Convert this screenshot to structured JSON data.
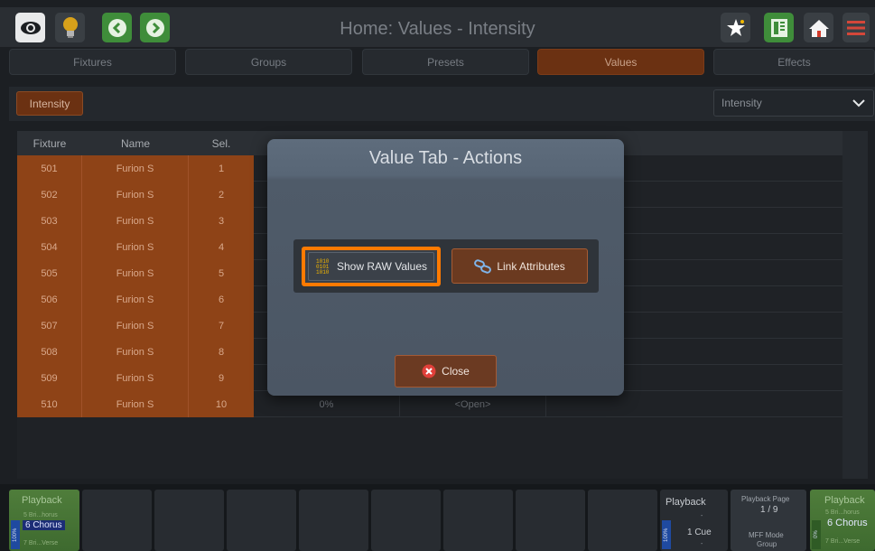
{
  "header": {
    "title": "Home: Values - Intensity",
    "icons": [
      "eye-icon",
      "bulb-icon",
      "back-icon",
      "forward-icon",
      "star-icon",
      "list-icon",
      "home-icon",
      "menu-icon"
    ]
  },
  "tabs": [
    {
      "label": "Fixtures"
    },
    {
      "label": "Groups"
    },
    {
      "label": "Presets"
    },
    {
      "label": "Values"
    },
    {
      "label": "Effects"
    }
  ],
  "filter": {
    "intensity_button": "Intensity",
    "select_value": "Intensity"
  },
  "table": {
    "headers": {
      "fixture": "Fixture",
      "name": "Name",
      "sel": "Sel."
    },
    "rows": [
      {
        "fixture": "501",
        "name": "Furion S",
        "sel": "1"
      },
      {
        "fixture": "502",
        "name": "Furion S",
        "sel": "2"
      },
      {
        "fixture": "503",
        "name": "Furion S",
        "sel": "3"
      },
      {
        "fixture": "504",
        "name": "Furion S",
        "sel": "4"
      },
      {
        "fixture": "505",
        "name": "Furion S",
        "sel": "5"
      },
      {
        "fixture": "506",
        "name": "Furion S",
        "sel": "6"
      },
      {
        "fixture": "507",
        "name": "Furion S",
        "sel": "7"
      },
      {
        "fixture": "508",
        "name": "Furion S",
        "sel": "8"
      },
      {
        "fixture": "509",
        "name": "Furion S",
        "sel": "9"
      },
      {
        "fixture": "510",
        "name": "Furion S",
        "sel": "10",
        "value": "0%",
        "mode": "<Open>"
      }
    ]
  },
  "modal": {
    "title": "Value Tab - Actions",
    "raw_button": "Show RAW Values",
    "link_button": "Link Attributes",
    "close_button": "Close"
  },
  "playback": {
    "left": {
      "title": "Playback",
      "prev": "5 Bri...horus",
      "current": "6 Chorus",
      "next": "7 Bri...Verse",
      "pct": "100%"
    },
    "center": {
      "title": "Playback",
      "dash1": "-",
      "cue": "1 Cue",
      "dash2": "-",
      "pct": "100%"
    },
    "page": {
      "label": "Playback Page",
      "value": "1 / 9",
      "mode_label": "MFF Mode",
      "mode_value": "Group"
    },
    "right": {
      "title": "Playback",
      "prev": "5 Bri...horus",
      "current": "6 Chorus",
      "next": "7 Bri...Verse",
      "pct": "0%"
    }
  },
  "colors": {
    "accent_orange": "#ff7a00",
    "selected_row": "#8e4317",
    "playback_green": "#4f7d3b"
  }
}
